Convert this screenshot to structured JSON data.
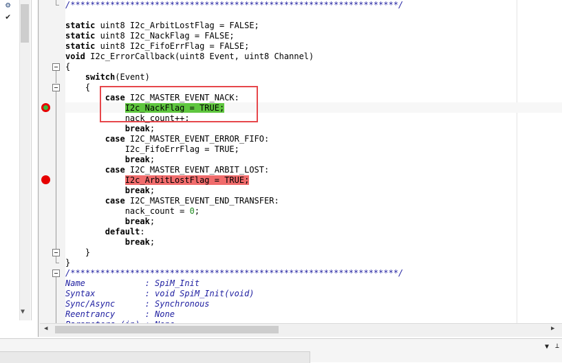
{
  "left_panel": {
    "icons": [
      "gear-icon",
      "checkmark-icon"
    ]
  },
  "editor": {
    "lines": [
      [
        {
          "t": "/******************************************************************/",
          "c": "comment"
        }
      ],
      [],
      [
        {
          "t": "static",
          "c": "kw"
        },
        {
          "t": " uint8 I2c_ArbitLostFlag = FALSE;"
        }
      ],
      [
        {
          "t": "static",
          "c": "kw"
        },
        {
          "t": " uint8 I2c_NackFlag = FALSE;"
        }
      ],
      [
        {
          "t": "static",
          "c": "kw"
        },
        {
          "t": " uint8 I2c_FifoErrFlag = FALSE;"
        }
      ],
      [
        {
          "t": "void",
          "c": "kw"
        },
        {
          "t": " I2c_ErrorCallback(uint8 Event, uint8 Channel)"
        }
      ],
      [
        {
          "t": "{"
        }
      ],
      [
        {
          "t": "    "
        },
        {
          "t": "switch",
          "c": "kw"
        },
        {
          "t": "(Event)"
        }
      ],
      [
        {
          "t": "    {"
        }
      ],
      [
        {
          "t": "        "
        },
        {
          "t": "case",
          "c": "kw"
        },
        {
          "t": " I2C_MASTER_EVENT_NACK:"
        }
      ],
      [
        {
          "t": "            "
        },
        {
          "t": "I2c_NackFlag = TRUE;",
          "c": "hl-green"
        }
      ],
      [
        {
          "t": "            nack_count++;"
        }
      ],
      [
        {
          "t": "            "
        },
        {
          "t": "break",
          "c": "kw"
        },
        {
          "t": ";"
        }
      ],
      [
        {
          "t": "        "
        },
        {
          "t": "case",
          "c": "kw"
        },
        {
          "t": " I2C_MASTER_EVENT_ERROR_FIFO:"
        }
      ],
      [
        {
          "t": "            I2c_FifoErrFlag = TRUE;"
        }
      ],
      [
        {
          "t": "            "
        },
        {
          "t": "break",
          "c": "kw"
        },
        {
          "t": ";"
        }
      ],
      [
        {
          "t": "        "
        },
        {
          "t": "case",
          "c": "kw"
        },
        {
          "t": " I2C_MASTER_EVENT_ARBIT_LOST:"
        }
      ],
      [
        {
          "t": "            "
        },
        {
          "t": "I2c_ArbitLostFlag = TRUE;",
          "c": "hl-red"
        }
      ],
      [
        {
          "t": "            "
        },
        {
          "t": "break",
          "c": "kw"
        },
        {
          "t": ";"
        }
      ],
      [
        {
          "t": "        "
        },
        {
          "t": "case",
          "c": "kw"
        },
        {
          "t": " I2C_MASTER_EVENT_END_TRANSFER:"
        }
      ],
      [
        {
          "t": "            nack_count = "
        },
        {
          "t": "0",
          "c": "num"
        },
        {
          "t": ";"
        }
      ],
      [
        {
          "t": "            "
        },
        {
          "t": "break",
          "c": "kw"
        },
        {
          "t": ";"
        }
      ],
      [
        {
          "t": "        "
        },
        {
          "t": "default",
          "c": "kw"
        },
        {
          "t": ":"
        }
      ],
      [
        {
          "t": "            "
        },
        {
          "t": "break",
          "c": "kw"
        },
        {
          "t": ";"
        }
      ],
      [
        {
          "t": "    }"
        }
      ],
      [
        {
          "t": "}"
        }
      ],
      [
        {
          "t": "/******************************************************************/",
          "c": "comment"
        }
      ],
      [
        {
          "t": "Name            : SpiM_Init",
          "c": "comment"
        }
      ],
      [
        {
          "t": "Syntax          : void SpiM_Init(void)",
          "c": "comment"
        }
      ],
      [
        {
          "t": "Sync/Async      : Synchronous",
          "c": "comment"
        }
      ],
      [
        {
          "t": "Reentrancy      : None",
          "c": "comment"
        }
      ],
      [
        {
          "t": "Parameters (in) : None",
          "c": "comment"
        }
      ]
    ]
  },
  "breakpoints": [
    {
      "line_index": 10,
      "icon": "breakpoint-current-icon"
    },
    {
      "line_index": 17,
      "icon": "breakpoint-icon"
    }
  ],
  "colors": {
    "highlight_current": "#5fc63f",
    "highlight_breakpoint": "#f06c6c",
    "annotation_box": "#e6464a"
  },
  "status_bar": {
    "icons": [
      "dropdown-arrow-icon",
      "pin-icon"
    ]
  }
}
